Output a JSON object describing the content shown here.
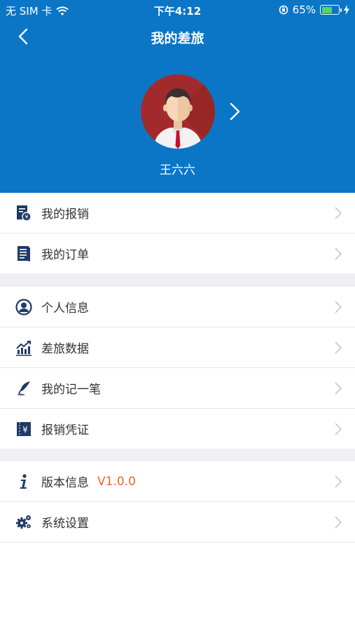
{
  "status": {
    "carrier": "无 SIM 卡",
    "time": "下午4:12",
    "battery": "65%",
    "battery_level": 0.65,
    "icons": [
      "wifi-icon",
      "orientation-lock-icon",
      "battery-icon",
      "charging-icon"
    ]
  },
  "nav": {
    "title": "我的差旅",
    "back_icon": "chevron-left-icon"
  },
  "profile": {
    "name": "王六六",
    "avatar": "male-avatar",
    "chevron_icon": "chevron-right-icon"
  },
  "colors": {
    "header": "#0B76C6",
    "accent": "#E5672B",
    "icon": "#1E3A66",
    "background_gap": "#EFEFF4"
  },
  "groups": [
    {
      "items": [
        {
          "label": "我的报销",
          "icon": "reimbursement-icon"
        },
        {
          "label": "我的订单",
          "icon": "order-list-icon"
        }
      ]
    },
    {
      "items": [
        {
          "label": "个人信息",
          "icon": "user-circle-icon"
        },
        {
          "label": "差旅数据",
          "icon": "chart-icon"
        },
        {
          "label": "我的记一笔",
          "icon": "quill-pen-icon"
        },
        {
          "label": "报销凭证",
          "icon": "voucher-icon"
        }
      ]
    },
    {
      "items": [
        {
          "label": "版本信息",
          "icon": "info-icon",
          "value": "V1.0.0"
        },
        {
          "label": "系统设置",
          "icon": "gears-icon"
        }
      ]
    }
  ]
}
